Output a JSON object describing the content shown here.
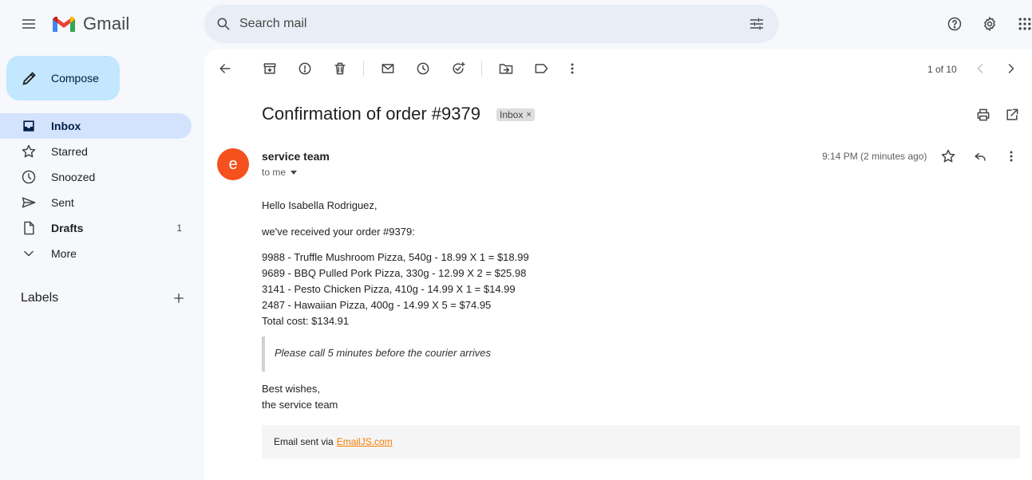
{
  "app": {
    "name": "Gmail"
  },
  "search": {
    "placeholder": "Search mail"
  },
  "compose": {
    "label": "Compose"
  },
  "sidebar": {
    "items": [
      {
        "label": "Inbox",
        "icon": "inbox-icon"
      },
      {
        "label": "Starred",
        "icon": "star-icon"
      },
      {
        "label": "Snoozed",
        "icon": "clock-icon"
      },
      {
        "label": "Sent",
        "icon": "send-icon"
      },
      {
        "label": "Drafts",
        "icon": "draft-icon",
        "count": "1"
      },
      {
        "label": "More",
        "icon": "chevron-down-icon"
      }
    ],
    "labels_heading": "Labels"
  },
  "toolbar": {
    "pager": "1 of 10"
  },
  "email": {
    "subject": "Confirmation of order #9379",
    "chip": "Inbox",
    "chip_close": "×",
    "avatar_letter": "e",
    "sender": "service team",
    "to": "to me",
    "timestamp": "9:14 PM (2 minutes ago)",
    "greeting": "Hello Isabella Rodriguez,",
    "intro": "we've received your order #9379:",
    "lines": [
      "9988 - Truffle Mushroom Pizza, 540g - 18.99 X 1 = $18.99",
      "9689 - BBQ Pulled Pork Pizza, 330g - 12.99 X 2 = $25.98",
      "3141 - Pesto Chicken Pizza, 410g - 14.99 X 1 = $14.99",
      "2487 - Hawaiian Pizza, 400g - 14.99 X 5 = $74.95"
    ],
    "total": "Total cost: $134.91",
    "note": "Please call 5 minutes before the courier arrives",
    "signoff_1": "Best wishes,",
    "signoff_2": "the service team",
    "footer_text": "Email sent via",
    "footer_link": "EmailJS.com"
  },
  "colors": {
    "avatar": "#f4511e",
    "compose_bg": "#c2e7ff",
    "active_nav": "#d3e3fd",
    "footer_link": "#f57c00"
  }
}
